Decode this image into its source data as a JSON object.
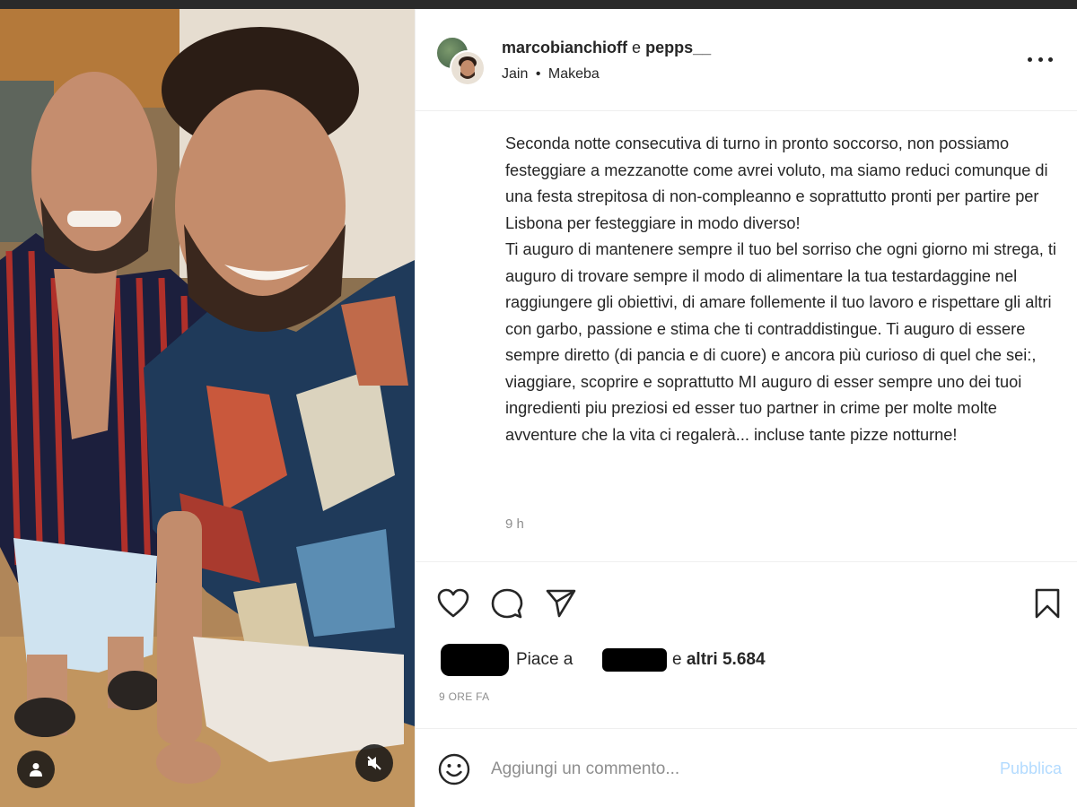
{
  "post": {
    "author": "marcobianchioff",
    "conjunction": "e",
    "coauthor": "pepps__",
    "music_artist": "Jain",
    "music_separator": "•",
    "music_track": "Makeba",
    "caption": "Seconda notte consecutiva di turno in pronto soccorso, non possiamo festeggiare a mezzanotte come avrei voluto, ma siamo reduci comunque di una festa strepitosa di non-compleanno e soprattutto pronti per partire per Lisbona per festeggiare in modo diverso!\nTi auguro di mantenere sempre il tuo bel sorriso che ogni giorno mi strega, ti auguro di trovare sempre il modo di alimentare la tua testardaggine nel raggiungere gli obiettivi, di amare follemente il tuo lavoro e rispettare gli altri con garbo, passione e stima che ti contraddistingue. Ti auguro di essere sempre diretto (di pancia e di cuore) e ancora più curioso di quel che sei:, viaggiare, scoprire e soprattutto MI auguro di esser sempre uno dei tuoi ingredienti piu preziosi ed esser tuo partner in crime per molte molte avventure che la vita ci regalerà... incluse tante pizze notturne!",
    "caption_time": "9 h",
    "likes_prefix": "Piace a",
    "likes_suffix_conj": "e",
    "likes_others": "altri 5.684",
    "date": "9 ORE FA"
  },
  "comment": {
    "placeholder": "Aggiungi un commento...",
    "publish_label": "Pubblica"
  },
  "icons": {
    "like": "heart-icon",
    "comment": "comment-bubble-icon",
    "share": "paper-plane-icon",
    "save": "bookmark-icon",
    "more": "more-dots-icon",
    "emoji": "emoji-smile-icon",
    "user_tag": "user-tag-icon",
    "mute": "speaker-muted-icon"
  },
  "colors": {
    "text": "#262626",
    "secondary": "#8e8e8e",
    "publish_disabled": "#b3dbff",
    "divider": "#efefef"
  }
}
